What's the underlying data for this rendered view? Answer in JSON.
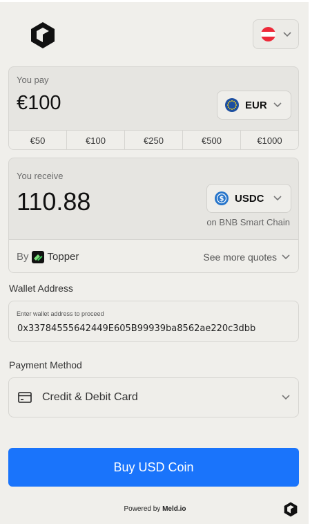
{
  "header": {
    "logo_icon": "meld-logo-icon",
    "country": {
      "flag": "austria-flag-icon",
      "colors": [
        "#ed2939",
        "#ffffff",
        "#ed2939"
      ]
    }
  },
  "pay": {
    "label": "You pay",
    "amount": "€100",
    "currency": "EUR",
    "currency_icon": "eur-icon",
    "presets": [
      "€50",
      "€100",
      "€250",
      "€500",
      "€1000"
    ]
  },
  "receive": {
    "label": "You receive",
    "amount": "110.88",
    "currency": "USDC",
    "currency_icon": "usdc-icon",
    "network": "on BNB Smart Chain",
    "by_label": "By",
    "provider": "Topper",
    "more_quotes": "See more quotes"
  },
  "wallet": {
    "section_label": "Wallet Address",
    "placeholder": "Enter wallet address to proceed",
    "value": "0x33784555642449E605B99939ba8562ae220c3dbb"
  },
  "payment": {
    "section_label": "Payment Method",
    "method": "Credit & Debit Card",
    "method_icon": "credit-card-icon"
  },
  "buy_button": "Buy USD Coin",
  "footer": {
    "powered_prefix": "Powered by",
    "powered_brand": "Meld.io"
  },
  "colors": {
    "accent": "#1a74fb",
    "background": "#f0efeb",
    "card": "#e6e5e1"
  }
}
